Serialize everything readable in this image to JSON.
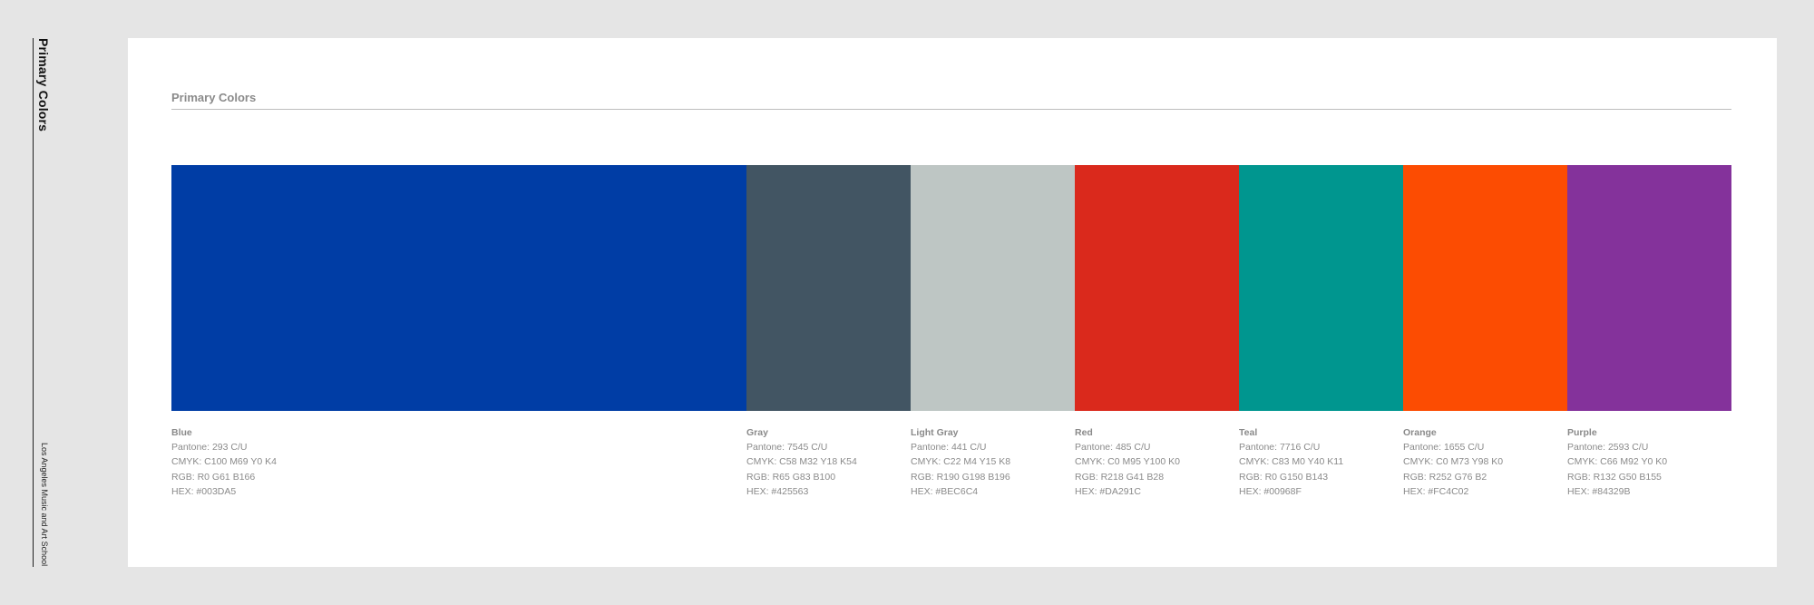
{
  "sidebar": {
    "title": "Primary Colors",
    "subtitle": "Los Angeles Music and Art School"
  },
  "section": {
    "title": "Primary Colors"
  },
  "colors": [
    {
      "name": "Blue",
      "pantone": "Pantone: 293 C/U",
      "cmyk": "CMYK: C100 M69 Y0 K4",
      "rgb": "RGB: R0 G61 B166",
      "hex_label": "HEX: #003DA5",
      "hex": "#003DA5"
    },
    {
      "name": "Gray",
      "pantone": "Pantone: 7545 C/U",
      "cmyk": "CMYK: C58 M32 Y18 K54",
      "rgb": "RGB: R65 G83 B100",
      "hex_label": "HEX: #425563",
      "hex": "#425563"
    },
    {
      "name": "Light Gray",
      "pantone": "Pantone: 441 C/U",
      "cmyk": "CMYK: C22 M4 Y15 K8",
      "rgb": "RGB: R190 G198 B196",
      "hex_label": "HEX: #BEC6C4",
      "hex": "#BEC6C4"
    },
    {
      "name": "Red",
      "pantone": "Pantone: 485 C/U",
      "cmyk": "CMYK: C0 M95 Y100 K0",
      "rgb": "RGB: R218 G41 B28",
      "hex_label": "HEX: #DA291C",
      "hex": "#DA291C"
    },
    {
      "name": "Teal",
      "pantone": "Pantone: 7716 C/U",
      "cmyk": "CMYK: C83 M0 Y40 K11",
      "rgb": "RGB: R0 G150 B143",
      "hex_label": "HEX: #00968F",
      "hex": "#00968F"
    },
    {
      "name": "Orange",
      "pantone": "Pantone: 1655 C/U",
      "cmyk": "CMYK: C0 M73 Y98 K0",
      "rgb": "RGB: R252 G76 B2",
      "hex_label": "HEX: #FC4C02",
      "hex": "#FC4C02"
    },
    {
      "name": "Purple",
      "pantone": "Pantone: 2593 C/U",
      "cmyk": "CMYK: C66 M92 Y0 K0",
      "rgb": "RGB: R132 G50 B155",
      "hex_label": "HEX: #84329B",
      "hex": "#84329B"
    }
  ]
}
